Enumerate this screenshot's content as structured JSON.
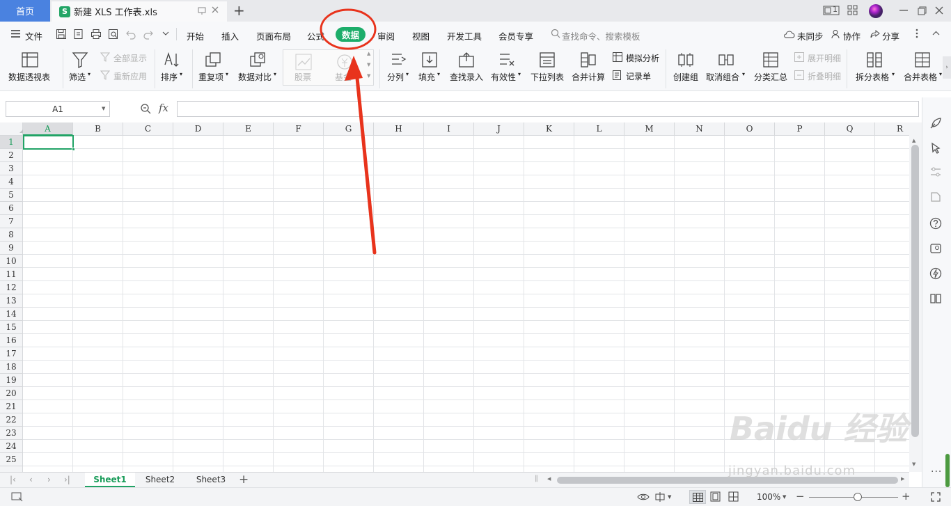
{
  "titlebar": {
    "home_tab": "首页",
    "doc_tab": "新建 XLS 工作表.xls",
    "doc_icon_letter": "S",
    "new_tab_symbol": "+",
    "badge": "1"
  },
  "menu": {
    "file": "文件",
    "tabs": [
      "开始",
      "插入",
      "页面布局",
      "公式",
      "数据",
      "审阅",
      "视图",
      "开发工具",
      "会员专享"
    ],
    "active_tab": "数据",
    "search_placeholder": "查找命令、搜索模板",
    "sync": "未同步",
    "collab": "协作",
    "share": "分享"
  },
  "ribbon": {
    "pivot": "数据透视表",
    "filter": "筛选",
    "show_all": "全部显示",
    "reapply": "重新应用",
    "sort": "排序",
    "duplicates": "重复项",
    "compare": "数据对比",
    "stock": "股票",
    "fund": "基金",
    "split": "分列",
    "fill": "填充",
    "lookup": "查找录入",
    "validity": "有效性",
    "dropdown_list": "下拉列表",
    "consolidate": "合并计算",
    "simulate": "模拟分析",
    "record_form": "记录单",
    "create_group": "创建组",
    "ungroup": "取消组合",
    "subtotal": "分类汇总",
    "expand_detail": "展开明细",
    "collapse_detail": "折叠明细",
    "split_table": "拆分表格",
    "merge_table": "合并表格"
  },
  "formula_bar": {
    "name_box": "A1",
    "fx": "fx",
    "value": ""
  },
  "sheet": {
    "columns": [
      "A",
      "B",
      "C",
      "D",
      "E",
      "F",
      "G",
      "H",
      "I",
      "J",
      "K",
      "L",
      "M",
      "N",
      "O",
      "P",
      "Q",
      "R"
    ],
    "rows": [
      "1",
      "2",
      "3",
      "4",
      "5",
      "6",
      "7",
      "8",
      "9",
      "10",
      "11",
      "12",
      "13",
      "14",
      "15",
      "16",
      "17",
      "18",
      "19",
      "20",
      "21",
      "22",
      "23",
      "24",
      "25"
    ],
    "active_cell": "A1"
  },
  "sheet_tabs": {
    "tabs": [
      "Sheet1",
      "Sheet2",
      "Sheet3"
    ],
    "active": "Sheet1",
    "add_symbol": "+"
  },
  "statusbar": {
    "zoom": "100%",
    "zoom_fraction": 0.55
  },
  "watermark": {
    "brand": "Baidu 经验",
    "url": "jingyan.baidu.com"
  },
  "colors": {
    "accent_green": "#1cad6a",
    "home_tab_blue": "#4a82e0",
    "annotation_red": "#e8331c"
  }
}
